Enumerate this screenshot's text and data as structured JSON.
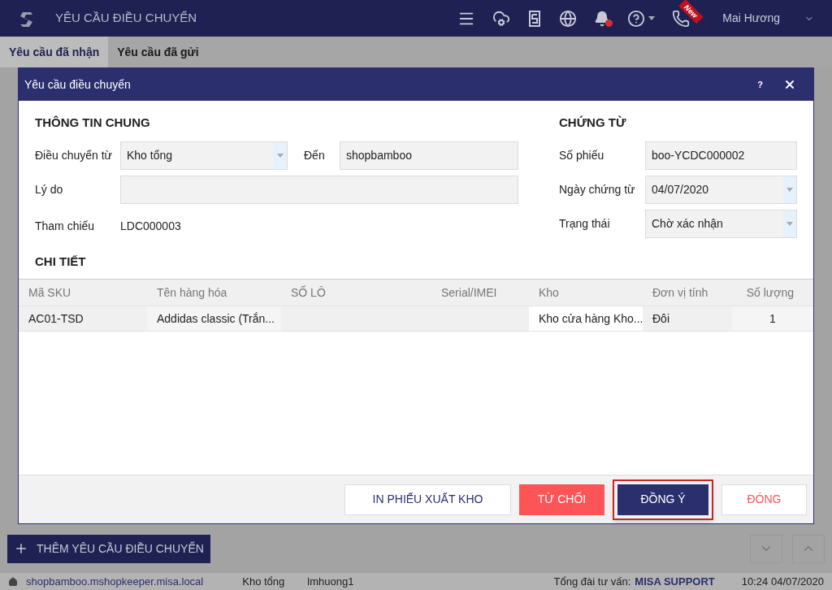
{
  "app_bar": {
    "title": "YÊU CẦU ĐIỀU CHUYỂN",
    "new_ribbon": "New",
    "user": "Mai Hương",
    "notification_dot": true
  },
  "tabs": [
    {
      "label": "Yêu cầu đã nhận",
      "selected": true
    },
    {
      "label": "Yêu cầu đã gửi",
      "selected": false
    }
  ],
  "dialog": {
    "title": "Yêu cầu điều chuyển",
    "help": "?",
    "general": {
      "heading": "THÔNG TIN CHUNG",
      "from_label": "Điều chuyển từ",
      "from_value": "Kho tổng",
      "to_label": "Đến",
      "to_value": "shopbamboo",
      "reason_label": "Lý do",
      "ref_label": "Tham chiếu",
      "ref_value": "LDC000003"
    },
    "voucher": {
      "heading": "CHỨNG TỪ",
      "fields": [
        {
          "label": "Số phiếu",
          "value": "boo-YCDC000002",
          "kind": "text"
        },
        {
          "label": "Ngày chứng từ",
          "value": "04/07/2020",
          "kind": "select"
        },
        {
          "label": "Trạng thái",
          "value": "Chờ xác nhận",
          "kind": "select"
        }
      ]
    },
    "detail_heading": "CHI TIẾT",
    "table": {
      "columns": [
        "Mã SKU",
        "Tên hàng hóa",
        "SỐ LÔ",
        "Serial/IMEI",
        "Kho",
        "Đơn vị tính",
        "Số lượng"
      ],
      "rows": [
        [
          "AC01-TSD",
          "Addidas classic (Trắn...",
          "",
          "",
          "Kho cửa hàng Kho...",
          "Đôi",
          "1"
        ]
      ]
    },
    "buttons": [
      {
        "label": "IN PHIẾU XUẤT KHO",
        "kind": "outline",
        "focused": false
      },
      {
        "label": "TỪ CHỐI",
        "kind": "danger",
        "focused": false
      },
      {
        "label": "ĐỒNG Ý",
        "kind": "primary",
        "focused": true
      },
      {
        "label": "ĐÓNG",
        "kind": "plain",
        "focused": false
      }
    ]
  },
  "add_button": "THÊM YÊU CẦU ĐIỀU CHUYỂN",
  "status_bar": {
    "domain": "shopbamboo.mshopkeeper.misa.local",
    "store": "Kho tổng",
    "user": "lmhuong1",
    "support_label": "Tổng đài tư vấn:",
    "support_link": "MISA SUPPORT",
    "datetime": "10:24 04/07/2020"
  }
}
